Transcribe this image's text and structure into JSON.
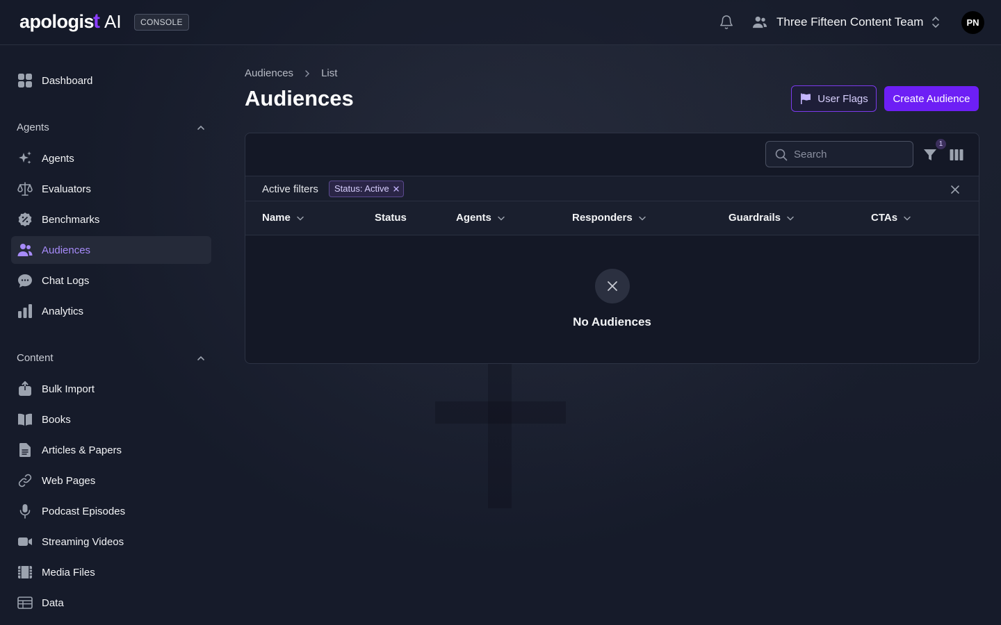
{
  "brand": {
    "logo_text": "apologis",
    "logo_mark": "t",
    "logo_ai": "AI",
    "badge": "CONSOLE"
  },
  "header": {
    "team_name": "Three Fifteen Content Team",
    "avatar_initials": "PN"
  },
  "sidebar": {
    "dashboard": "Dashboard",
    "agents_section": "Agents",
    "agents_items": [
      "Agents",
      "Evaluators",
      "Benchmarks",
      "Audiences",
      "Chat Logs",
      "Analytics"
    ],
    "content_section": "Content",
    "content_items": [
      "Bulk Import",
      "Books",
      "Articles & Papers",
      "Web Pages",
      "Podcast Episodes",
      "Streaming Videos",
      "Media Files",
      "Data"
    ]
  },
  "breadcrumb": {
    "root": "Audiences",
    "current": "List"
  },
  "page": {
    "title": "Audiences"
  },
  "actions": {
    "user_flags": "User Flags",
    "create": "Create Audience"
  },
  "table": {
    "search_placeholder": "Search",
    "filter_count": "1",
    "active_filters_label": "Active filters",
    "filter_chip": "Status: Active",
    "columns": [
      "Name",
      "Status",
      "Agents",
      "Responders",
      "Guardrails",
      "CTAs"
    ],
    "empty_text": "No Audiences"
  },
  "colors": {
    "accent": "#6d1ff5",
    "active_nav": "#a78bfa",
    "background": "#161b2a"
  }
}
